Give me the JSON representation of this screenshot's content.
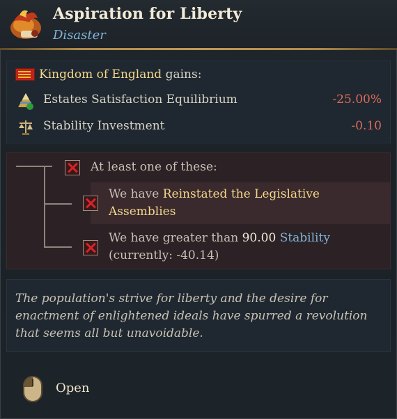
{
  "header": {
    "title": "Aspiration for Liberty",
    "subtitle": "Disaster",
    "icon": "disaster-fire-scroll-icon"
  },
  "gains": {
    "country": "Kingdom of England",
    "suffix": "gains:",
    "modifiers": [
      {
        "label": "Estates Satisfaction Equilibrium",
        "value": "-25.00%",
        "icon": "estates-pyramid-icon"
      },
      {
        "label": "Stability Investment",
        "value": "-0.10",
        "icon": "stability-scales-icon"
      }
    ]
  },
  "conditions": {
    "header": "At least one of these:",
    "items": [
      {
        "prefix": "We have ",
        "highlight": "Reinstated the Legislative Assemblies"
      },
      {
        "prefix": "We have greater than ",
        "number": "90.00",
        "link": "Stability",
        "current": "(currently: -40.14)"
      }
    ]
  },
  "description": "The population's strive for liberty and the desire for enactment of enlightened ideals have spurred a revolution that seems all but unavoidable.",
  "footer": {
    "action": "Open",
    "icon": "mouse-left-click-icon"
  },
  "colors": {
    "accent_gold": "#f3d68a",
    "link_blue": "#7fb4d8",
    "negative_red": "#e06a5c"
  }
}
